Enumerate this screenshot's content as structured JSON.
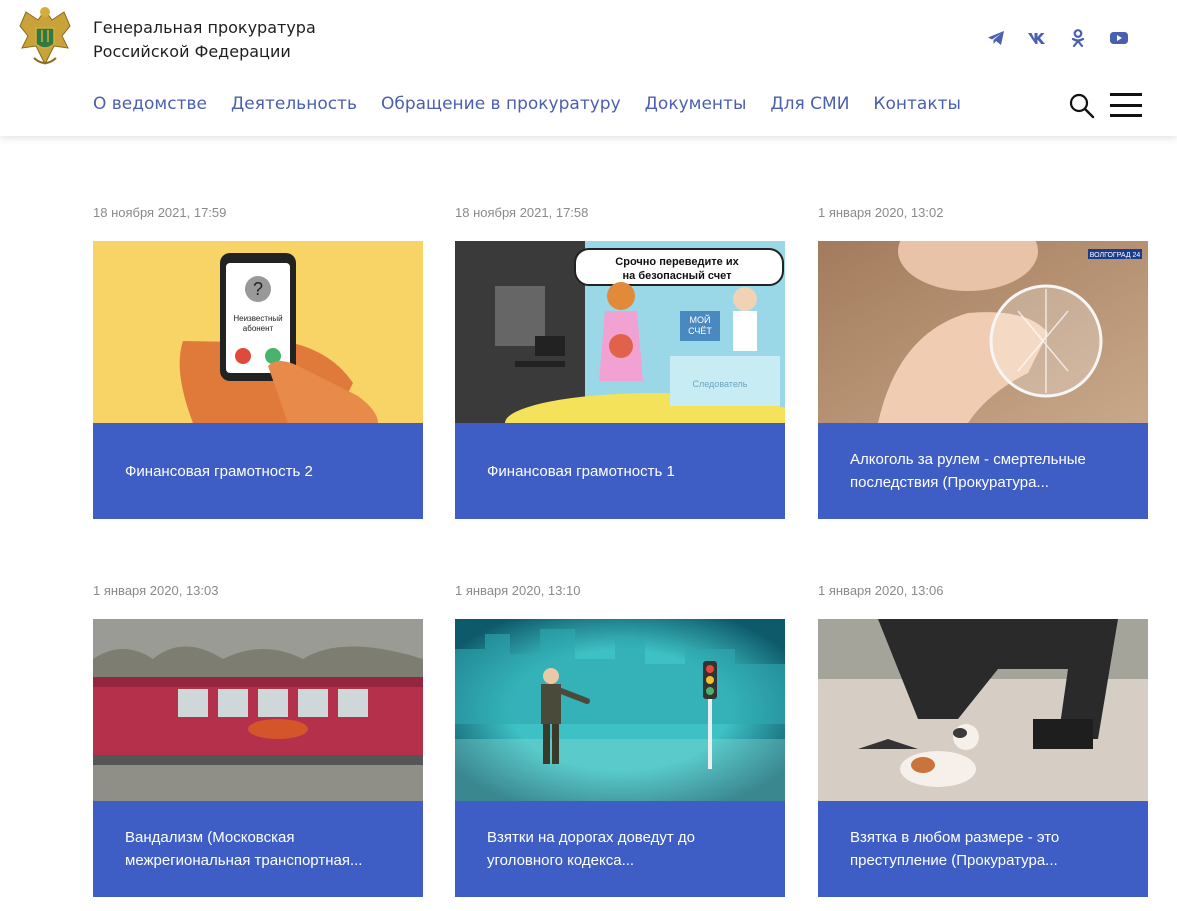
{
  "header": {
    "org_line1": "Генеральная прокуратура",
    "org_line2": "Российской Федерации",
    "social": [
      "telegram-icon",
      "vk-icon",
      "odnoklassniki-icon",
      "youtube-icon"
    ],
    "nav": [
      "О ведомстве",
      "Деятельность",
      "Обращение в прокуратуру",
      "Документы",
      "Для СМИ",
      "Контакты"
    ]
  },
  "colors": {
    "accent": "#3f5ec5",
    "nav_text": "#4a5fb0"
  },
  "cards": [
    {
      "date": "18 ноября 2021, 17:59",
      "title": "Финансовая грамотность 2"
    },
    {
      "date": "18 ноября 2021, 17:58",
      "title": "Финансовая грамотность 1"
    },
    {
      "date": "1 января 2020, 13:02",
      "title": "Алкоголь за рулем - смертельные последствия (Прокуратура..."
    },
    {
      "date": "1 января 2020, 13:03",
      "title": "Вандализм (Московская межрегиональная транспортная..."
    },
    {
      "date": "1 января 2020, 13:10",
      "title": "Взятки на дорогах доведут до уголовного кодекса..."
    },
    {
      "date": "1 января 2020, 13:06",
      "title": "Взятка в любом размере - это преступление (Прокуратура..."
    }
  ],
  "thumb_text": {
    "phone_label": "Неизвестный абонент",
    "speech": "Срочно переведите их на безопасный счет",
    "account": "МОЙ СЧЁТ",
    "desk": "Следователь",
    "channel_badge": "ВОЛГОГРАД 24"
  }
}
